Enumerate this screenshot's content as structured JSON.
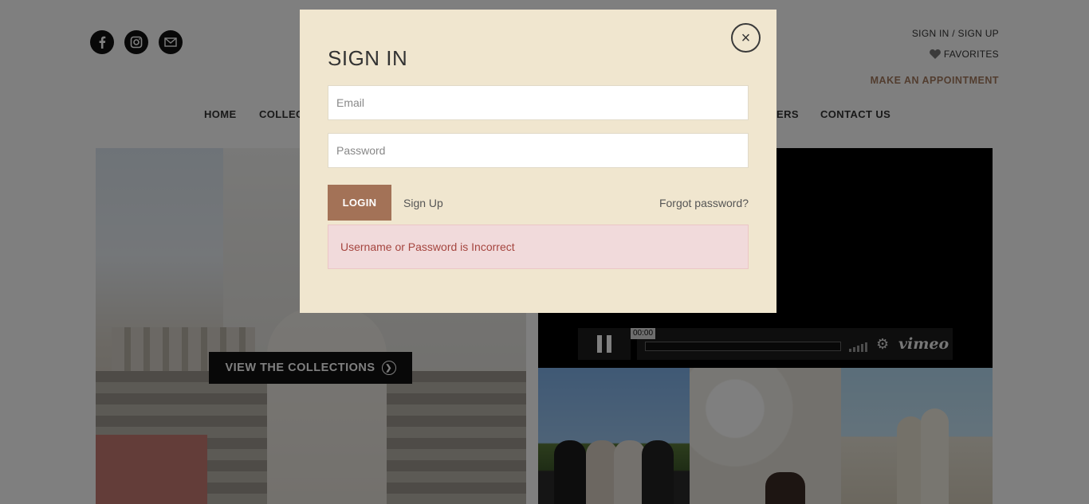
{
  "header": {
    "social": [
      {
        "name": "facebook-icon",
        "glyph": "f"
      },
      {
        "name": "instagram-icon",
        "glyph": ""
      },
      {
        "name": "mail-icon",
        "glyph": ""
      }
    ],
    "sign_in_signup": "SIGN IN / SIGN UP",
    "favorites": "FAVORITES",
    "make_appointment": "MAKE AN APPOINTMENT"
  },
  "nav": {
    "home": "HOME",
    "collections_partial": "COLLEC",
    "retailers_partial": "ERS",
    "contact_us": "CONTACT US"
  },
  "hero": {
    "view_collections": "VIEW THE COLLECTIONS"
  },
  "video": {
    "time": "00:00",
    "logo": "vimeo"
  },
  "modal": {
    "title": "SIGN IN",
    "email_placeholder": "Email",
    "password_placeholder": "Password",
    "login_label": "LOGIN",
    "signup_label": "Sign Up",
    "forgot_label": "Forgot password?",
    "error_message": "Username or Password is Incorrect",
    "close_glyph": "×"
  },
  "colors": {
    "modal_bg": "#f0e6cf",
    "accent": "#a37257",
    "error_text": "#a5453f",
    "error_bg": "#f1dadb"
  }
}
